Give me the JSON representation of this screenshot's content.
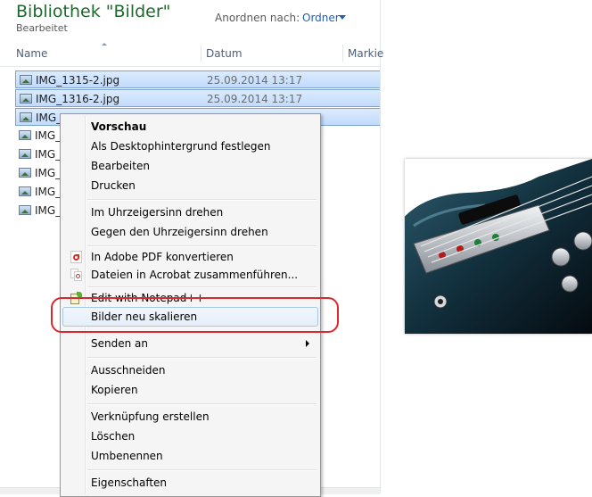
{
  "library": {
    "title": "Bibliothek \"Bilder\"",
    "subtitle": "Bearbeitet",
    "arrange_label": "Anordnen nach:",
    "arrange_value": "Ordner"
  },
  "columns": {
    "name": "Name",
    "date": "Datum",
    "tag": "Markie"
  },
  "files": [
    {
      "name": "IMG_1315-2.jpg",
      "date": "25.09.2014 13:17",
      "selected": true
    },
    {
      "name": "IMG_1316-2.jpg",
      "date": "25.09.2014 13:17",
      "selected": true
    },
    {
      "name": "IMG_1",
      "date": "",
      "selected": true
    },
    {
      "name": "IMG_",
      "date": "",
      "selected": false
    },
    {
      "name": "IMG_",
      "date": "",
      "selected": false
    },
    {
      "name": "IMG_",
      "date": "",
      "selected": false
    },
    {
      "name": "IMG_",
      "date": "",
      "selected": false
    },
    {
      "name": "IMG_",
      "date": "",
      "selected": false
    }
  ],
  "context_menu": {
    "preview": "Vorschau",
    "set_desktop": "Als Desktophintergrund festlegen",
    "edit": "Bearbeiten",
    "print": "Drucken",
    "rotate_cw": "Im Uhrzeigersinn drehen",
    "rotate_ccw": "Gegen den Uhrzeigersinn drehen",
    "convert_pdf": "In Adobe PDF konvertieren",
    "combine_acrobat": "Dateien in Acrobat zusammenführen...",
    "edit_notepad": "Edit with Notepad++",
    "resize_images": "Bilder neu skalieren",
    "send_to": "Senden an",
    "cut": "Ausschneiden",
    "copy": "Kopieren",
    "create_shortcut": "Verknüpfung erstellen",
    "delete": "Löschen",
    "rename": "Umbenennen",
    "properties": "Eigenschaften"
  },
  "colors": {
    "title_green": "#1e6a2e",
    "link_blue": "#1f5fae",
    "annotation_red": "#d9282e"
  }
}
